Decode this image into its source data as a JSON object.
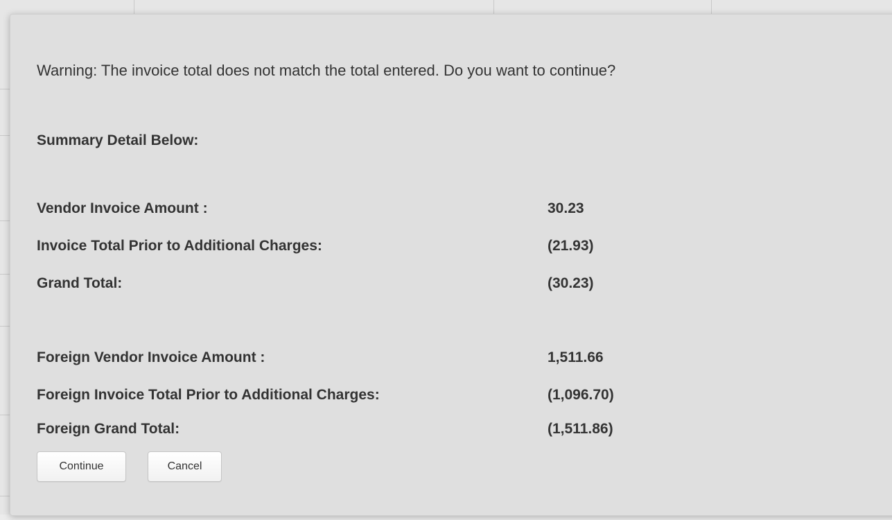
{
  "dialog": {
    "warning_text": "Warning: The invoice total does not match the total entered. Do you want to continue?",
    "summary_heading": "Summary Detail Below:",
    "summary_rows": [
      {
        "label": "Vendor Invoice Amount :",
        "value": "30.23"
      },
      {
        "label": "Invoice Total Prior to Additional Charges:",
        "value": "(21.93)"
      },
      {
        "label": "Grand Total:",
        "value": "(30.23)"
      }
    ],
    "foreign_rows": [
      {
        "label": "Foreign Vendor Invoice Amount :",
        "value": "1,511.66"
      },
      {
        "label": "Foreign Invoice Total Prior to Additional Charges:",
        "value": "(1,096.70)"
      },
      {
        "label": "Foreign Grand Total:",
        "value": "(1,511.86)"
      }
    ],
    "buttons": {
      "continue_label": "Continue",
      "cancel_label": "Cancel"
    }
  },
  "colors": {
    "dialog_background": "#dfdfdf",
    "text": "#333333",
    "button_border": "#c4c4c4"
  }
}
